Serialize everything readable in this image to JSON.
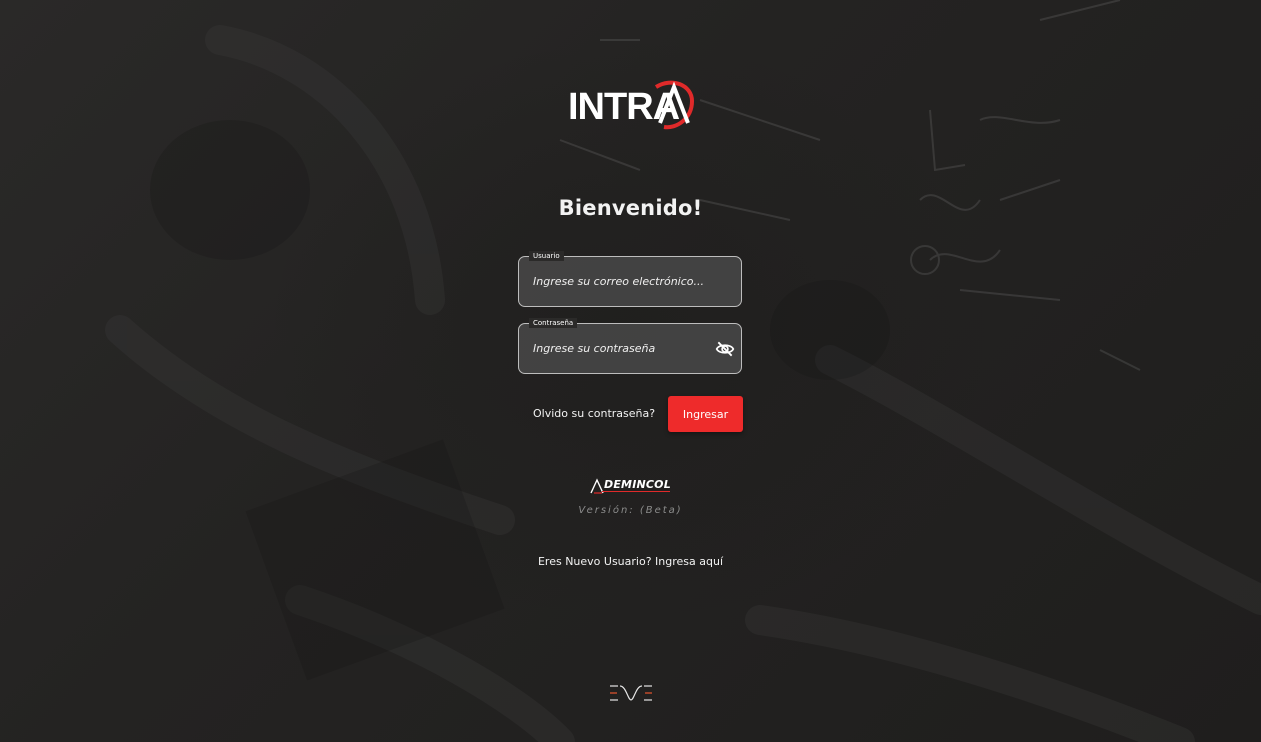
{
  "app": {
    "logo_text": "INTRA",
    "welcome_title": "Bienvenido!"
  },
  "form": {
    "username": {
      "label": "Usuario",
      "placeholder": "Ingrese su correo electrónico...",
      "value": ""
    },
    "password": {
      "label": "Contraseña",
      "placeholder": "Ingrese su contraseña",
      "value": "",
      "toggle_icon": "eye-off-icon"
    },
    "forgot_password_label": "Olvido su contraseña?",
    "submit_label": "Ingresar"
  },
  "footer": {
    "company_name": "DEMINCOL",
    "version_text": "Versión: (Beta)",
    "register_link": "Eres Nuevo Usuario? Ingresa aquí",
    "bottom_logo_icon": "dve-logo-icon"
  },
  "colors": {
    "accent": "#ee2b2b",
    "background": "#232222",
    "field_border": "#bdbdbd",
    "version_text": "#8c8c8c"
  }
}
